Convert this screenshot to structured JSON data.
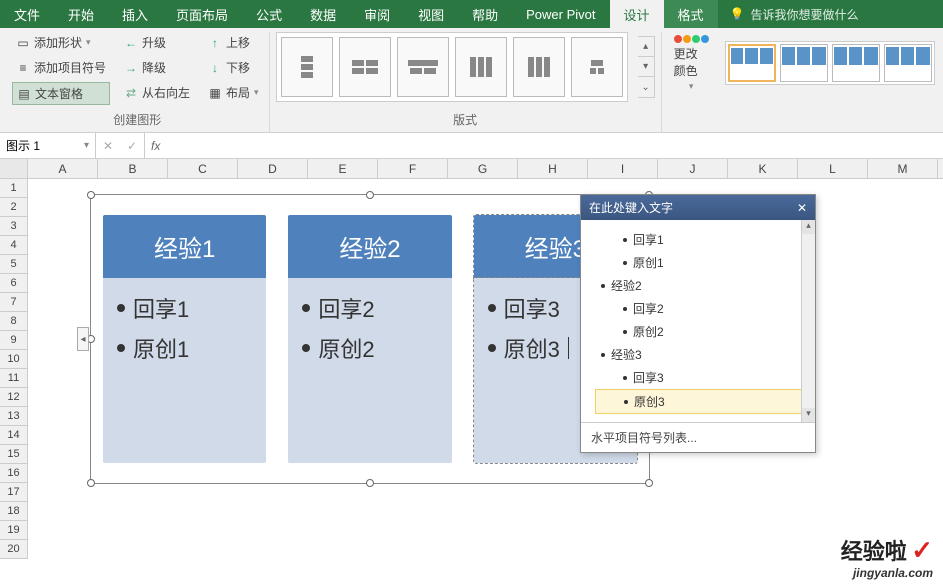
{
  "tabs": {
    "file": "文件",
    "home": "开始",
    "insert": "插入",
    "page_layout": "页面布局",
    "formulas": "公式",
    "data": "数据",
    "review": "审阅",
    "view": "视图",
    "help": "帮助",
    "power_pivot": "Power Pivot",
    "design": "设计",
    "format": "格式"
  },
  "tellme": {
    "placeholder": "告诉我你想要做什么"
  },
  "ribbon": {
    "create_graphic": {
      "add_shape": "添加形状",
      "add_bullet": "添加项目符号",
      "text_pane": "文本窗格",
      "promote": "升级",
      "demote": "降级",
      "rtl": "从右向左",
      "move_up": "上移",
      "move_down": "下移",
      "layout": "布局",
      "group_label": "创建图形"
    },
    "layouts_group": "版式",
    "change_colors": "更改颜色"
  },
  "name_box": "图示 1",
  "columns": [
    "A",
    "B",
    "C",
    "D",
    "E",
    "F",
    "G",
    "H",
    "I",
    "J",
    "K",
    "L",
    "M"
  ],
  "rows": [
    "1",
    "2",
    "3",
    "4",
    "5",
    "6",
    "7",
    "8",
    "9",
    "10",
    "11",
    "12",
    "13",
    "14",
    "15",
    "16",
    "17",
    "18",
    "19",
    "20"
  ],
  "smartart": {
    "cols": [
      {
        "header": "经验1",
        "items": [
          "回享1",
          "原创1"
        ]
      },
      {
        "header": "经验2",
        "items": [
          "回享2",
          "原创2"
        ]
      },
      {
        "header": "经验3",
        "items": [
          "回享3",
          "原创3"
        ]
      }
    ]
  },
  "text_pane": {
    "title": "在此处键入文字",
    "items": [
      {
        "text": "回享1",
        "level": 2
      },
      {
        "text": "原创1",
        "level": 2
      },
      {
        "text": "经验2",
        "level": 1
      },
      {
        "text": "回享2",
        "level": 2
      },
      {
        "text": "原创2",
        "level": 2
      },
      {
        "text": "经验3",
        "level": 1
      },
      {
        "text": "回享3",
        "level": 2
      },
      {
        "text": "原创3",
        "level": 2,
        "selected": true
      }
    ],
    "footer": "水平项目符号列表..."
  },
  "watermark": {
    "text": "经验啦",
    "url": "jingyanla.com"
  }
}
